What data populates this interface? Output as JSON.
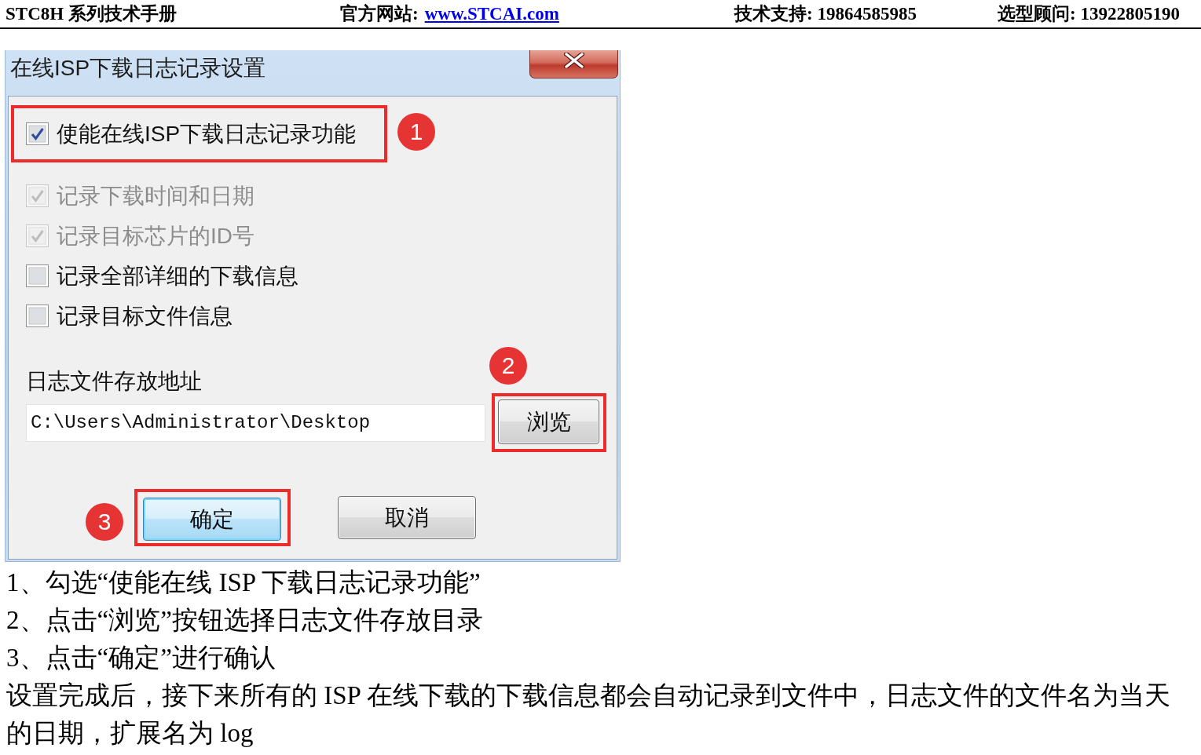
{
  "header": {
    "title": "STC8H 系列技术手册",
    "website": {
      "label": "官方网站:",
      "link": "www.STCAI.com"
    },
    "support": "技术支持: 19864585985",
    "consultant": "选型顾问: 13922805190"
  },
  "dialog": {
    "title": "在线ISP下载日志记录设置",
    "options": [
      {
        "label": "使能在线ISP下载日志记录功能",
        "checked": true,
        "disabled": false,
        "callout": "1"
      },
      {
        "label": "记录下载时间和日期",
        "checked": true,
        "disabled": true
      },
      {
        "label": "记录目标芯片的ID号",
        "checked": true,
        "disabled": true
      },
      {
        "label": "记录全部详细的下载信息",
        "checked": false,
        "disabled": false
      },
      {
        "label": "记录目标文件信息",
        "checked": false,
        "disabled": false
      }
    ],
    "path_label": "日志文件存放地址",
    "path_field": {
      "value": "C:\\Users\\Administrator\\Desktop"
    },
    "browse_button": {
      "label": "浏览",
      "callout": "2"
    },
    "buttons": [
      {
        "label": "确定",
        "default": true,
        "callout": "3"
      },
      {
        "label": "取消",
        "default": false
      }
    ]
  },
  "steps": [
    "1、勾选“使能在线 ISP 下载日志记录功能”",
    "2、点击“浏览”按钮选择日志文件存放目录",
    "3、点击“确定”进行确认"
  ],
  "note": "设置完成后，接下来所有的 ISP 在线下载的下载信息都会自动记录到文件中，日志文件的文件名为当天的日期，扩展名为 log"
}
